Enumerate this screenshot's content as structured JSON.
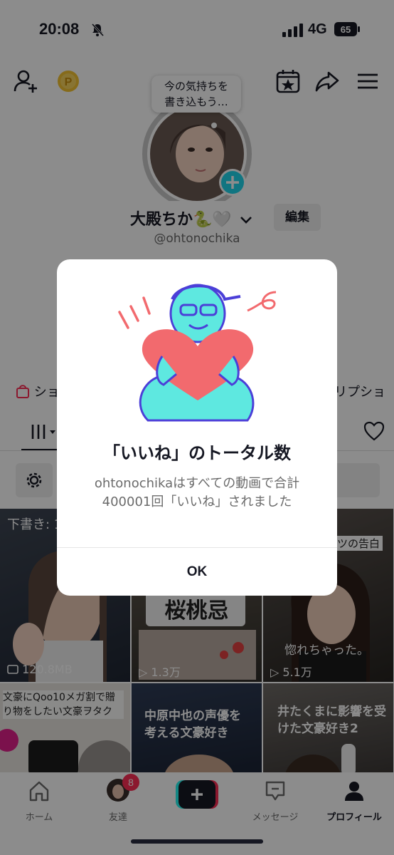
{
  "status_bar": {
    "time": "20:08",
    "network": "4G",
    "battery": "65"
  },
  "profile": {
    "tooltip_line1": "今の気持ちを",
    "tooltip_line2": "書き込もう…",
    "display_name": "大殿ちか🐍🤍",
    "handle": "@ohtonochika",
    "edit_label": "編集",
    "shop_label": "ショ",
    "subscription_label": "クリプショ"
  },
  "videos": [
    {
      "overlay_text": "下書き: 1",
      "views": "120.8MB"
    },
    {
      "overlay_text": "桜桃忌",
      "views": "1.3万"
    },
    {
      "overlay_text": "ツの告白",
      "caption": "惚れちゃった。",
      "views": "5.1万"
    },
    {
      "overlay_text": "文豪にQoo10メガ割で贈り物をしたい文豪ヲタク"
    },
    {
      "overlay_text": "中原中也の声優を考える文豪好き"
    },
    {
      "overlay_text": "井たくまに影響を受けた文豪好き2"
    }
  ],
  "modal": {
    "title": "「いいね」のトータル数",
    "body": "ohtonochikaはすべての動画で合計400001回「いいね」されました",
    "ok_label": "OK"
  },
  "bottom_nav": {
    "home": "ホーム",
    "friends": "友達",
    "friends_badge": "8",
    "messages": "メッセージ",
    "profile": "プロフィール"
  },
  "colors": {
    "accent_red": "#fe2c55",
    "accent_cyan": "#25f4ee",
    "illustration_heart": "#f26a6e",
    "illustration_figure": "#5ee8e0",
    "illustration_outline": "#4b3fd8"
  }
}
